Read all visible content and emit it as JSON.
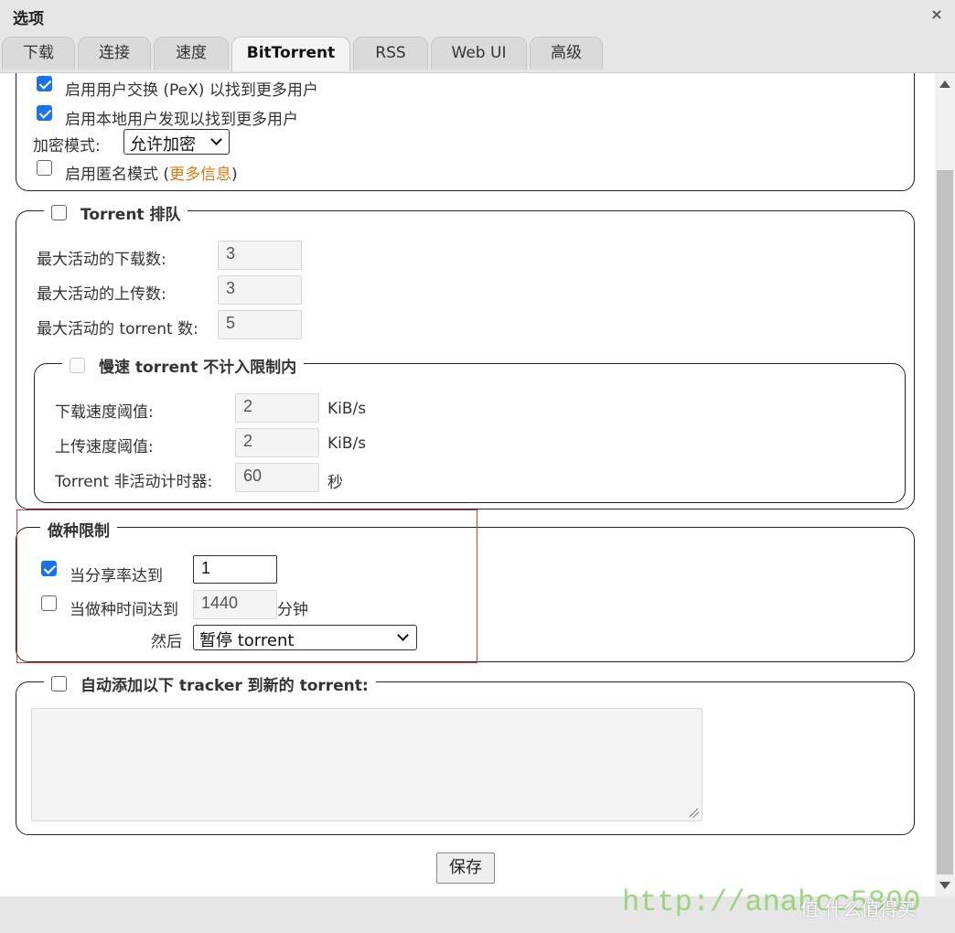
{
  "window": {
    "title": "选项",
    "close_glyph": "×"
  },
  "tabs": [
    {
      "label": "下载"
    },
    {
      "label": "连接"
    },
    {
      "label": "速度"
    },
    {
      "label": "BitTorrent"
    },
    {
      "label": "RSS"
    },
    {
      "label": "Web UI"
    },
    {
      "label": "高级"
    }
  ],
  "active_tab": "BitTorrent",
  "privacy": {
    "pex_label": "启用用户交换 (PeX) 以找到更多用户",
    "pex_checked": true,
    "lsd_label": "启用本地用户发现以找到更多用户",
    "lsd_checked": true,
    "encryption_label": "加密模式:",
    "encryption_value": "允许加密",
    "anonymous_label": "启用匿名模式 (",
    "anonymous_link": "更多信息",
    "anonymous_suffix": ")",
    "anonymous_checked": false
  },
  "queueing": {
    "legend": "Torrent 排队",
    "enabled": false,
    "max_downloads_label": "最大活动的下载数:",
    "max_downloads": "3",
    "max_uploads_label": "最大活动的上传数:",
    "max_uploads": "3",
    "max_torrents_label": "最大活动的 torrent 数:",
    "max_torrents": "5",
    "slow": {
      "legend": "慢速 torrent 不计入限制内",
      "enabled": false,
      "dl_rate_label": "下载速度阈值:",
      "dl_rate": "2",
      "dl_unit": "KiB/s",
      "ul_rate_label": "上传速度阈值:",
      "ul_rate": "2",
      "ul_unit": "KiB/s",
      "inactive_label": "Torrent 非活动计时器:",
      "inactive": "60",
      "inactive_unit": "秒"
    }
  },
  "seeding": {
    "legend": "做种限制",
    "ratio_label": "当分享率达到",
    "ratio_checked": true,
    "ratio_value": "1",
    "time_label": "当做种时间达到",
    "time_checked": false,
    "time_value": "1440",
    "time_unit": "分钟",
    "then_label": "然后",
    "action_value": "暂停 torrent"
  },
  "trackers": {
    "legend": "自动添加以下 tracker 到新的 torrent:",
    "enabled": false,
    "text": ""
  },
  "save_label": "保存",
  "watermark": "http://anahcc5800",
  "watermark2": "值 什么值得买"
}
